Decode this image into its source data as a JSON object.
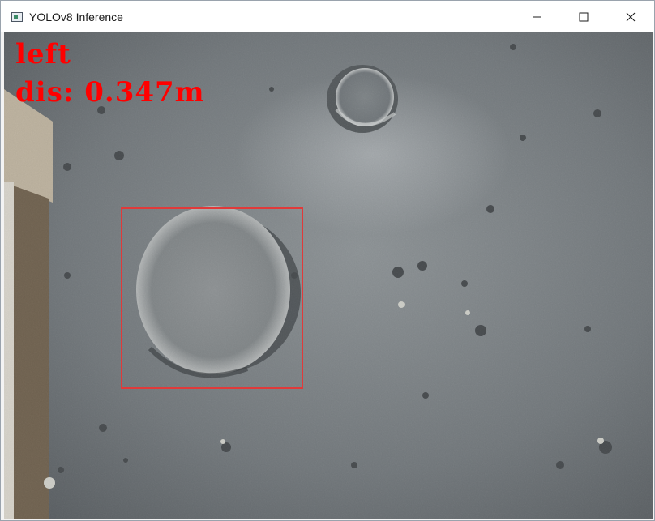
{
  "window": {
    "title": "YOLOv8 Inference",
    "icons": {
      "app": "app-window-icon",
      "minimize": "minimize-icon",
      "maximize": "maximize-icon",
      "close": "close-icon"
    }
  },
  "overlay": {
    "class_label": "left",
    "distance_label": "dis: 0.347m",
    "color": "#ff0000"
  },
  "detection": {
    "box_color": "#e03a3a"
  }
}
